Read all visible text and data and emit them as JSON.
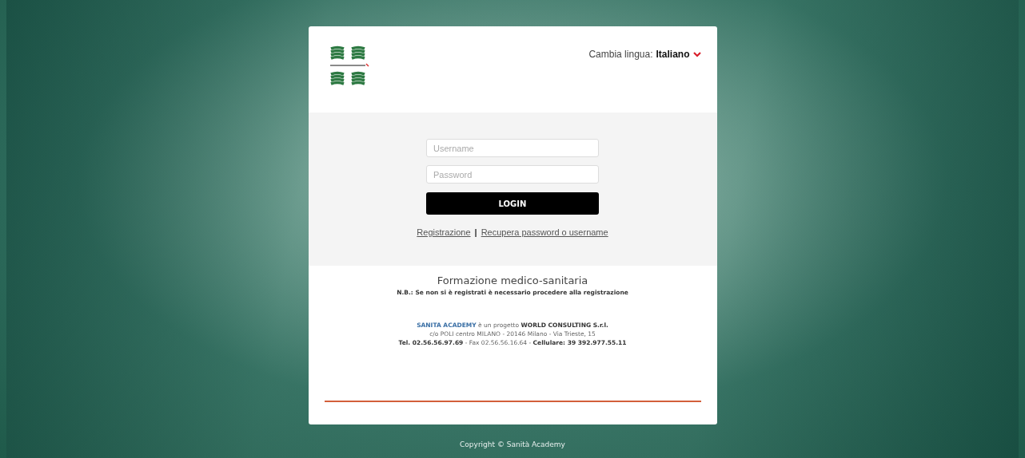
{
  "language": {
    "label": "Cambia lingua:",
    "value": "Italiano"
  },
  "login": {
    "username": {
      "placeholder": "Username"
    },
    "password": {
      "placeholder": "Password"
    },
    "button": "LOGIN",
    "links": [
      "Registrazione",
      "Recupera password o username"
    ],
    "separator": "|"
  },
  "info": {
    "title": "Formazione medico-sanitaria",
    "note": "N.B.: Se non si è registrati è necessario procedere alla registrazione",
    "lines": [
      [
        {
          "kind": "brand",
          "text": "SANITA ACADEMY"
        },
        {
          "kind": "plain",
          "text": " è un progetto "
        },
        {
          "kind": "bold",
          "text": "WORLD CONSULTING S.r.l."
        }
      ],
      [
        {
          "kind": "plain",
          "text": "c/o POLI centro MILANO - 20146 Milano - Via Trieste, 15"
        }
      ],
      [
        {
          "kind": "bold",
          "text": "Tel. 02.56.56.97.69"
        },
        {
          "kind": "plain",
          "text": " - Fax 02.56.56.16.64 - "
        },
        {
          "kind": "bold",
          "text": "Cellulare: 39 392.977.55.11"
        }
      ]
    ]
  },
  "copyright": "Copyright © Sanità Academy"
}
